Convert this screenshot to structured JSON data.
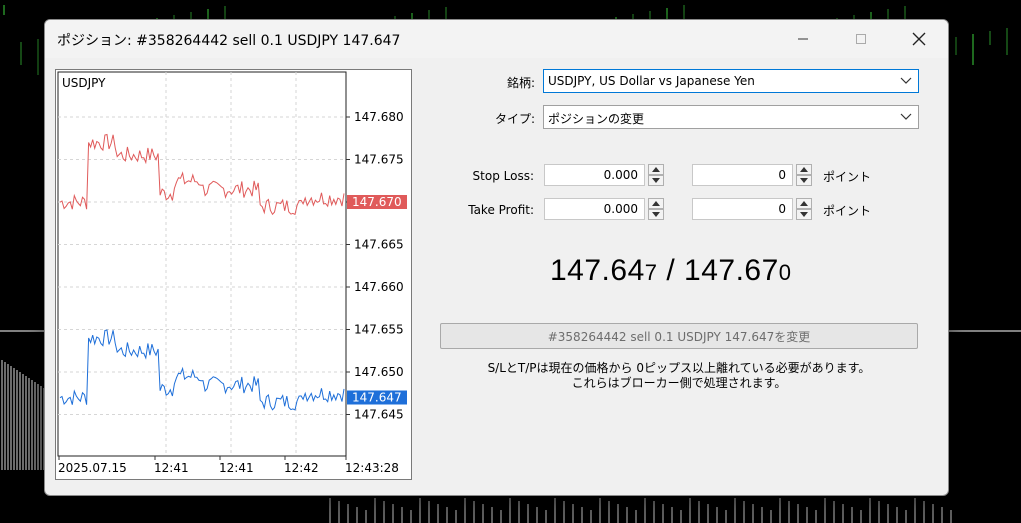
{
  "dialog": {
    "title": "ポジション: #358264442 sell 0.1 USDJPY 147.647"
  },
  "chart": {
    "symbol": "USDJPY",
    "ask_label": "147.670",
    "bid_label": "147.647",
    "ask_color": "#e05a5a",
    "bid_color": "#1e6fd9",
    "y_ticks": [
      "147.680",
      "147.675",
      "147.670",
      "147.665",
      "147.660",
      "147.655",
      "147.650",
      "147.645"
    ],
    "x_ticks": [
      "2025.07.15",
      "12:41",
      "12:41",
      "12:42",
      "12:43:28"
    ]
  },
  "form": {
    "symbol_label": "銘柄:",
    "symbol_value": "USDJPY, US Dollar vs Japanese Yen",
    "type_label": "タイプ:",
    "type_value": "ポジションの変更",
    "sl_label": "Stop Loss:",
    "sl_value": "0.000",
    "sl_points": "0",
    "tp_label": "Take Profit:",
    "tp_value": "0.000",
    "tp_points": "0",
    "points_unit": "ポイント"
  },
  "prices": {
    "bid_main": "147.64",
    "bid_last": "7",
    "separator": " / ",
    "ask_main": "147.67",
    "ask_last": "0"
  },
  "modify_button": "#358264442 sell 0.1 USDJPY 147.647を変更",
  "notice": {
    "line1": "S/LとT/Pは現在の価格から 0ピップス以上離れている必要があります。",
    "line2": "これらはブローカー側で処理されます。"
  }
}
